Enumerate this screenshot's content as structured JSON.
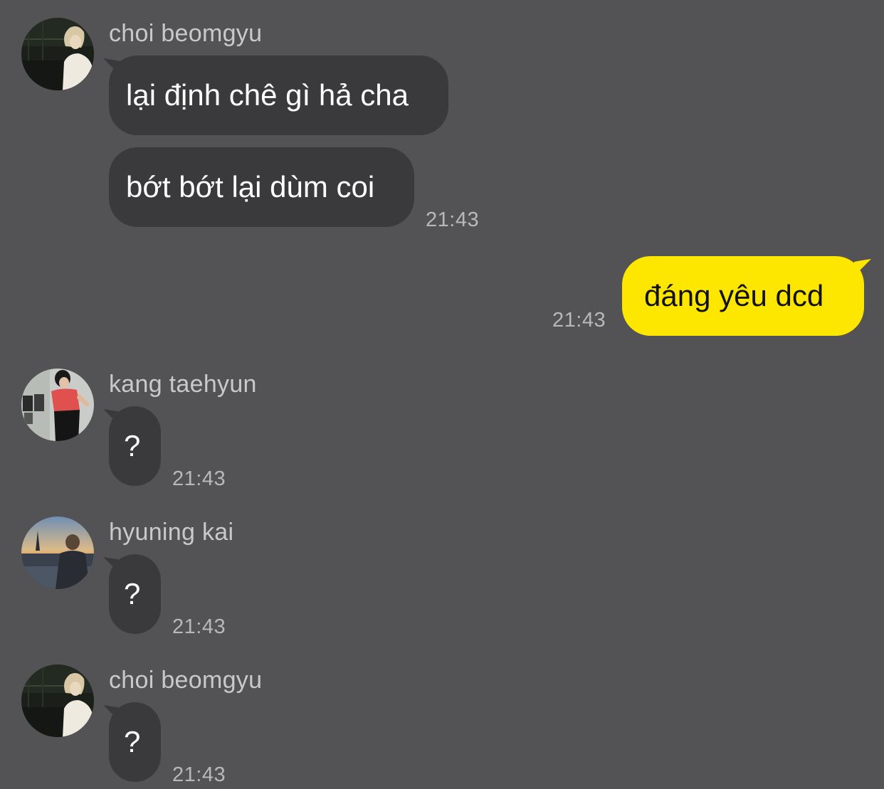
{
  "colors": {
    "background": "#535254",
    "incoming_bubble": "#3a393b",
    "outgoing_bubble": "#fde600",
    "name_text": "#c9c8ca",
    "time_text": "#b8b7b9"
  },
  "messages": [
    {
      "sender": "choi beomgyu",
      "avatar": "beomgyu-avatar",
      "bubbles": [
        "lại định chê gì hả cha",
        "bớt bớt lại dùm coi"
      ],
      "time": "21:43"
    },
    {
      "sender": "me",
      "bubbles": [
        "đáng yêu dcd"
      ],
      "time": "21:43"
    },
    {
      "sender": "kang taehyun",
      "avatar": "taehyun-avatar",
      "bubbles": [
        "?"
      ],
      "time": "21:43"
    },
    {
      "sender": "hyuning kai",
      "avatar": "hueningkai-avatar",
      "bubbles": [
        "?"
      ],
      "time": "21:43"
    },
    {
      "sender": "choi beomgyu",
      "avatar": "beomgyu-avatar",
      "bubbles": [
        "?"
      ],
      "time": "21:43"
    }
  ]
}
